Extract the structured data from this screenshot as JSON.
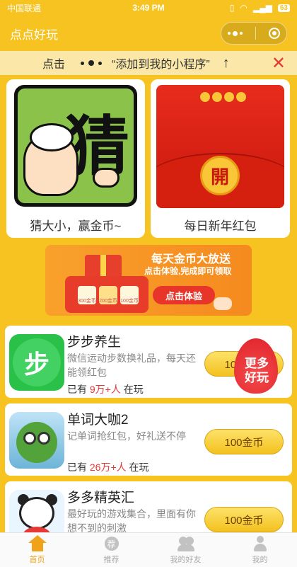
{
  "status": {
    "carrier": "中国联通",
    "time": "3:49 PM",
    "battery": "63"
  },
  "nav": {
    "title": "点点好玩"
  },
  "tip": {
    "prefix": "点击",
    "text": "“添加到我的小程序”",
    "arrow": "↑",
    "close": "✕"
  },
  "cards": [
    {
      "label": "猜大小，赢金币~",
      "art_char": "猜"
    },
    {
      "label": "每日新年红包",
      "art_char": "開"
    }
  ],
  "banner": {
    "headline": "每天金币大放送",
    "subline": "点击体验,完成即可领取",
    "button": "点击体验",
    "tiles": [
      "300金币",
      "200金币",
      "100金币"
    ]
  },
  "games": [
    {
      "name": "步步养生",
      "desc": "微信运动步数换礼品，每天还能领红包",
      "plays_prefix": "已有",
      "plays_num": "9万+人",
      "plays_suffix": "在玩",
      "button": "100金币",
      "icon_char": "步"
    },
    {
      "name": "单词大咖2",
      "desc": "记单词抢红包，好礼送不停",
      "plays_prefix": "已有",
      "plays_num": "26万+人",
      "plays_suffix": "在玩",
      "button": "100金币"
    },
    {
      "name": "多多精英汇",
      "desc": "最好玩的游戏集合，里面有你想不到的刺激",
      "plays_prefix": "",
      "plays_num": "",
      "plays_suffix": "",
      "button": "100金币"
    }
  ],
  "hot_badge": "更多\n好玩",
  "tabs": [
    {
      "label": "首页",
      "icon": "home-icon",
      "active": true
    },
    {
      "label": "推荐",
      "icon": "recommend-icon",
      "active": false
    },
    {
      "label": "我的好友",
      "icon": "friends-icon",
      "active": false
    },
    {
      "label": "我的",
      "icon": "profile-icon",
      "active": false
    }
  ],
  "colors": {
    "theme": "#f6c320",
    "accent_red": "#e53935",
    "tab_active": "#f0a31a"
  }
}
